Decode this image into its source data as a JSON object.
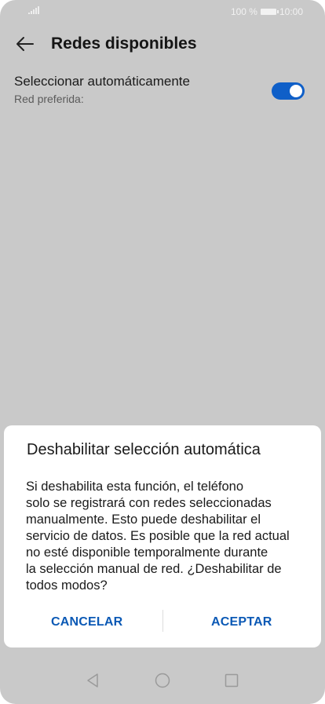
{
  "statusbar": {
    "battery_text": "100 %",
    "time": "10:00"
  },
  "appbar": {
    "title": "Redes disponibles"
  },
  "setting": {
    "title": "Seleccionar automáticamente",
    "subtitle": "Red preferida:",
    "toggle_on": true
  },
  "dialog": {
    "title": "Deshabilitar selección automática",
    "body_lines": [
      "Si deshabilita esta función, el teléfono",
      "solo se registrará con redes seleccionadas",
      "manualmente. Esto puede deshabilitar el",
      "servicio de datos. Es posible que la red actual",
      "no esté disponible temporalmente durante",
      "la selección manual de red. ¿Deshabilitar de",
      "todos modos?"
    ],
    "cancel_label": "CANCELAR",
    "accept_label": "ACEPTAR"
  },
  "icons": {
    "back": "back-arrow-icon",
    "nav_back": "triangle-back-icon",
    "nav_home": "circle-home-icon",
    "nav_recent": "square-recents-icon"
  },
  "colors": {
    "accent": "#0b59b5",
    "toggle": "#0f5fc8",
    "scrim": "#c9c9c9"
  }
}
